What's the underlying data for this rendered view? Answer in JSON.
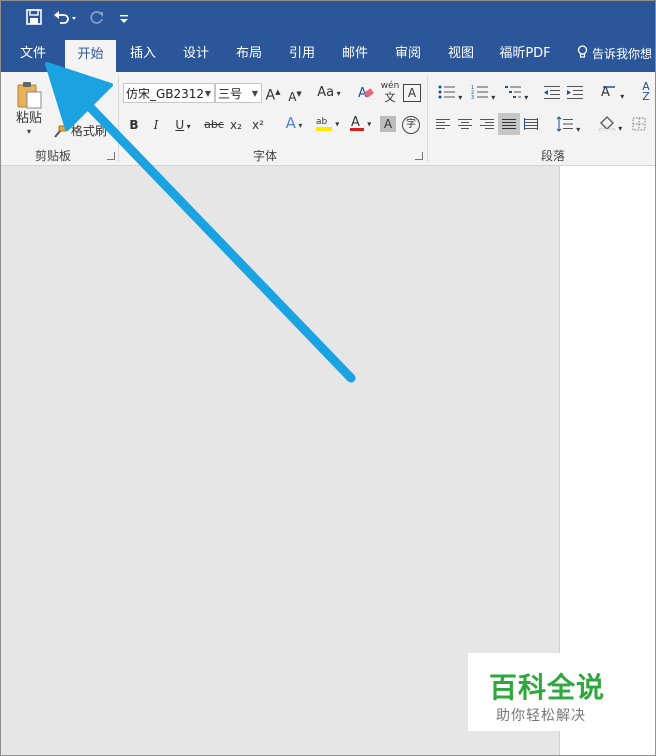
{
  "quick_access": {
    "save_icon": "save-icon",
    "undo_icon": "undo-icon",
    "redo_icon": "redo-icon",
    "customize_icon": "customize-qat-icon"
  },
  "tabs": [
    {
      "label": "文件",
      "active": false
    },
    {
      "label": "开始",
      "active": true
    },
    {
      "label": "插入",
      "active": false
    },
    {
      "label": "设计",
      "active": false
    },
    {
      "label": "布局",
      "active": false
    },
    {
      "label": "引用",
      "active": false
    },
    {
      "label": "邮件",
      "active": false
    },
    {
      "label": "审阅",
      "active": false
    },
    {
      "label": "视图",
      "active": false
    },
    {
      "label": "福昕PDF",
      "active": false
    }
  ],
  "tell_me": "告诉我你想",
  "clipboard": {
    "paste_label": "粘贴",
    "format_painter_label": "格式刷",
    "group_label": "剪贴板"
  },
  "font": {
    "font_name": "仿宋_GB2312",
    "font_size": "三号",
    "case_label": "Aa",
    "phonetic_top": "wén",
    "phonetic_bottom": "文",
    "bold": "B",
    "italic": "I",
    "underline": "U",
    "strike": "abc",
    "subscript": "x₂",
    "superscript": "x²",
    "enclose_char": "字",
    "group_label": "字体"
  },
  "paragraph": {
    "group_label": "段落"
  },
  "watermark": {
    "title": "百科全说",
    "subtitle": "助你轻松解决"
  },
  "colors": {
    "title_bar": "#2b579a",
    "ribbon": "#f3f3f3",
    "arrow": "#1aa3e0",
    "watermark_green": "#2ea73c"
  }
}
